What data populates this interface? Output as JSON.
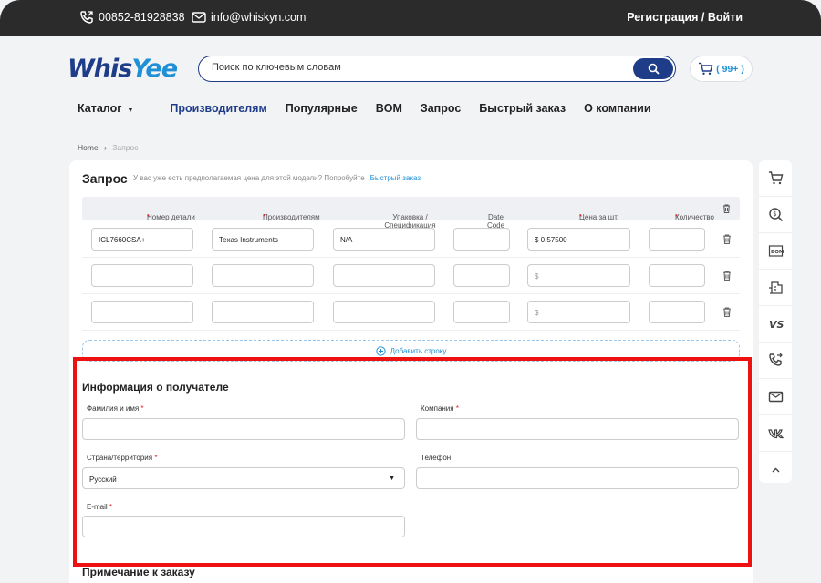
{
  "topbar": {
    "phone": "00852-81928838",
    "email": "info@whiskyn.com",
    "auth": "Регистрация / Войти"
  },
  "logo": {
    "part1": "Whis",
    "part2": "Yee"
  },
  "search": {
    "placeholder": "Поиск по ключевым словам"
  },
  "cart": {
    "count": "( 99+ )"
  },
  "nav": {
    "items": [
      "Каталог",
      "Производителям",
      "Популярные",
      "BOM",
      "Запрос",
      "Быстрый заказ",
      "О компании"
    ]
  },
  "breadcrumb": {
    "home": "Home",
    "current": "Запрос"
  },
  "request": {
    "title": "Запрос",
    "hint": "У вас уже есть предполагаемая цена для этой модели? Попробуйте",
    "hint_link": "Быстрый заказ",
    "columns": [
      "Номер детали",
      "Производителям",
      "Упаковка / Спецификация",
      "Date Code",
      "Цена за шт.",
      "Количество"
    ],
    "rows": [
      {
        "part": "ICL7660CSA+",
        "mfr": "Texas Instruments",
        "pack": "N/A",
        "date": "",
        "price": "$ 0.57500",
        "qty": ""
      },
      {
        "part": "",
        "mfr": "",
        "pack": "",
        "date": "",
        "price": "$",
        "qty": ""
      },
      {
        "part": "",
        "mfr": "",
        "pack": "",
        "date": "",
        "price": "$",
        "qty": ""
      }
    ],
    "add_row": "Добавить строку"
  },
  "recipient": {
    "title": "Информация о получателе",
    "name_label": "Фамилия и имя",
    "company_label": "Компания",
    "country_label": "Страна/территория",
    "country_value": "Русский",
    "phone_label": "Телефон",
    "email_label": "E-mail"
  },
  "order_note": {
    "title": "Примечание к заказу"
  },
  "colors": {
    "brand": "#1f3c88",
    "accent": "#1f8fd6",
    "highlight": "#ee1111"
  },
  "sidebar_icons": [
    "cart-icon",
    "price-search-icon",
    "bom-icon",
    "factory-icon",
    "vs-icon",
    "phone-forward-icon",
    "mail-icon",
    "vk-icon",
    "chevron-up-icon"
  ]
}
